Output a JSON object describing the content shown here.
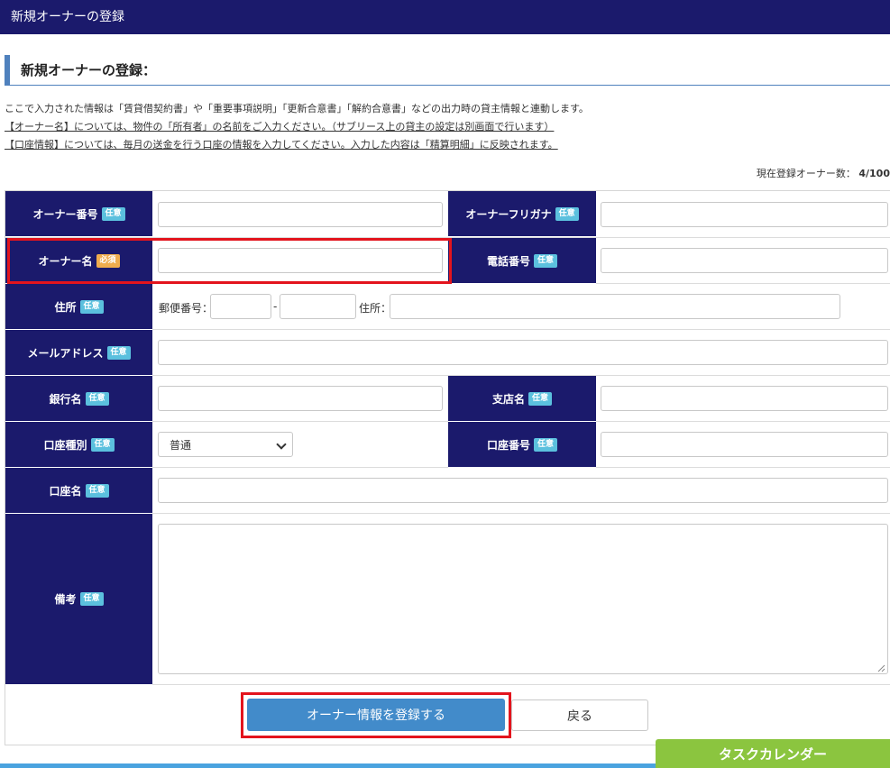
{
  "header": {
    "title": "新規オーナーの登録"
  },
  "section": {
    "title": "新規オーナーの登録："
  },
  "info": {
    "line1": "ここで入力された情報は「賃貸借契約書」や「重要事項説明」「更新合意書」「解約合意書」などの出力時の貸主情報と連動します。",
    "line2": "【オーナー名】については、物件の「所有者」の名前をご入力ください。（サブリース上の貸主の設定は別画面で行います）",
    "line3": "【口座情報】については、毎月の送金を行う口座の情報を入力してください。入力した内容は「精算明細」に反映されます。"
  },
  "count": {
    "label": "現在登録オーナー数：",
    "value": "4/100"
  },
  "badges": {
    "optional": "任意",
    "required": "必須"
  },
  "fields": {
    "owner_number": "オーナー番号",
    "owner_furigana": "オーナーフリガナ",
    "owner_name": "オーナー名",
    "phone": "電話番号",
    "address": "住所",
    "postal_label": "郵便番号：",
    "postal_dash": "-",
    "address_label": "住所：",
    "email": "メールアドレス",
    "bank_name": "銀行名",
    "branch_name": "支店名",
    "account_type": "口座種別",
    "account_type_value": "普通",
    "account_number": "口座番号",
    "account_name": "口座名",
    "remarks": "備考"
  },
  "buttons": {
    "submit": "オーナー情報を登録する",
    "back": "戻る"
  },
  "task_calendar": "タスクカレンダー",
  "colors": {
    "header_bg": "#1b1a6c",
    "primary": "#428bca",
    "optional_badge": "#5bc0de",
    "required_badge": "#f0ad4e",
    "highlight": "#e3141d",
    "task_calendar": "#8bc53f"
  }
}
